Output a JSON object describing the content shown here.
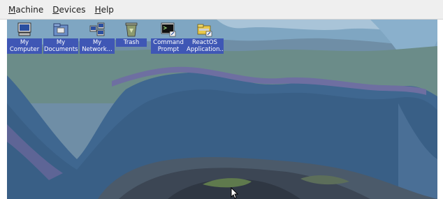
{
  "menubar": {
    "items": [
      {
        "accel": "M",
        "rest": "achine"
      },
      {
        "accel": "D",
        "rest": "evices"
      },
      {
        "accel": "H",
        "rest": "elp"
      }
    ]
  },
  "desktop": {
    "icons": [
      {
        "line1": "My",
        "line2": "Computer",
        "icon": "computer-icon"
      },
      {
        "line1": "My",
        "line2": "Documents",
        "icon": "folder-icon"
      },
      {
        "line1": "My",
        "line2": "Network...",
        "icon": "network-icon"
      },
      {
        "line1": "Trash",
        "line2": "",
        "icon": "recycle-bin-icon"
      },
      {
        "line1": "Command",
        "line2": "Prompt",
        "icon": "console-icon"
      },
      {
        "line1": "ReactOS",
        "line2": "Application...",
        "icon": "folder-shortcut-icon"
      }
    ]
  }
}
